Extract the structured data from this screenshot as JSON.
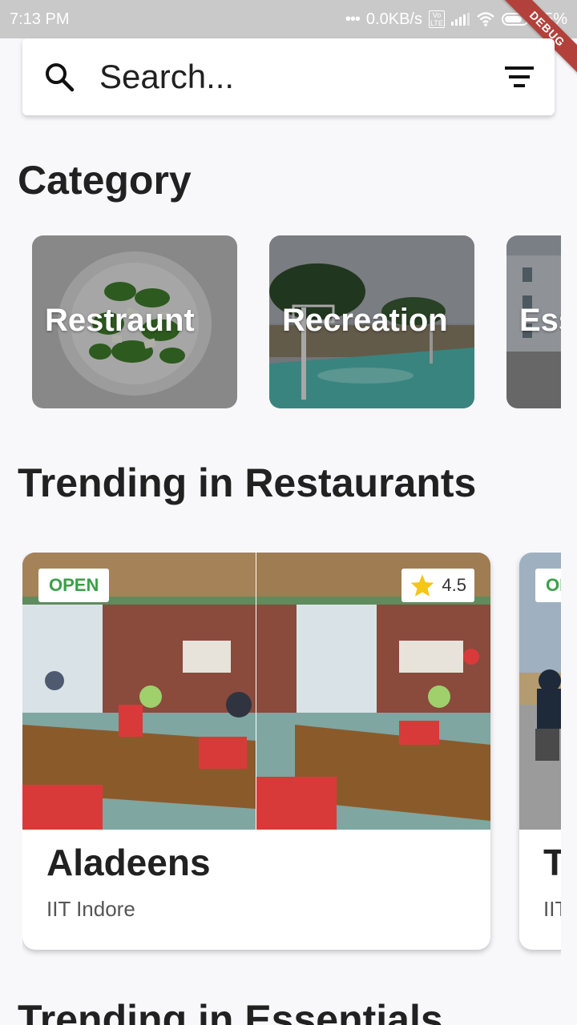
{
  "status_bar": {
    "time": "7:13 PM",
    "network_speed": "0.0KB/s",
    "volte": "Vo LTE",
    "battery": "75%",
    "debug_banner": "DEBUG"
  },
  "search": {
    "placeholder": "Search...",
    "search_icon": "search-icon",
    "filter_icon": "filter-icon"
  },
  "sections": {
    "category_title": "Category",
    "trending_restaurants_title": "Trending in Restaurants",
    "trending_essentials_title": "Trending in Essentials"
  },
  "categories": [
    {
      "label": "Restraunt"
    },
    {
      "label": "Recreation"
    },
    {
      "label": "Essentials",
      "visible_text": "Ess"
    }
  ],
  "trending_restaurants": [
    {
      "status": "OPEN",
      "rating": "4.5",
      "name": "Aladeens",
      "location": "IIT Indore"
    },
    {
      "status": "OPEN",
      "status_visible": "OI",
      "name_visible": "T",
      "location_visible": "IIT"
    }
  ],
  "colors": {
    "open_green": "#3aa048",
    "star_yellow": "#f5c518",
    "debug_red": "#b3413b",
    "status_bar_bg": "#c9c9c9",
    "page_bg": "#f8f8fb"
  }
}
